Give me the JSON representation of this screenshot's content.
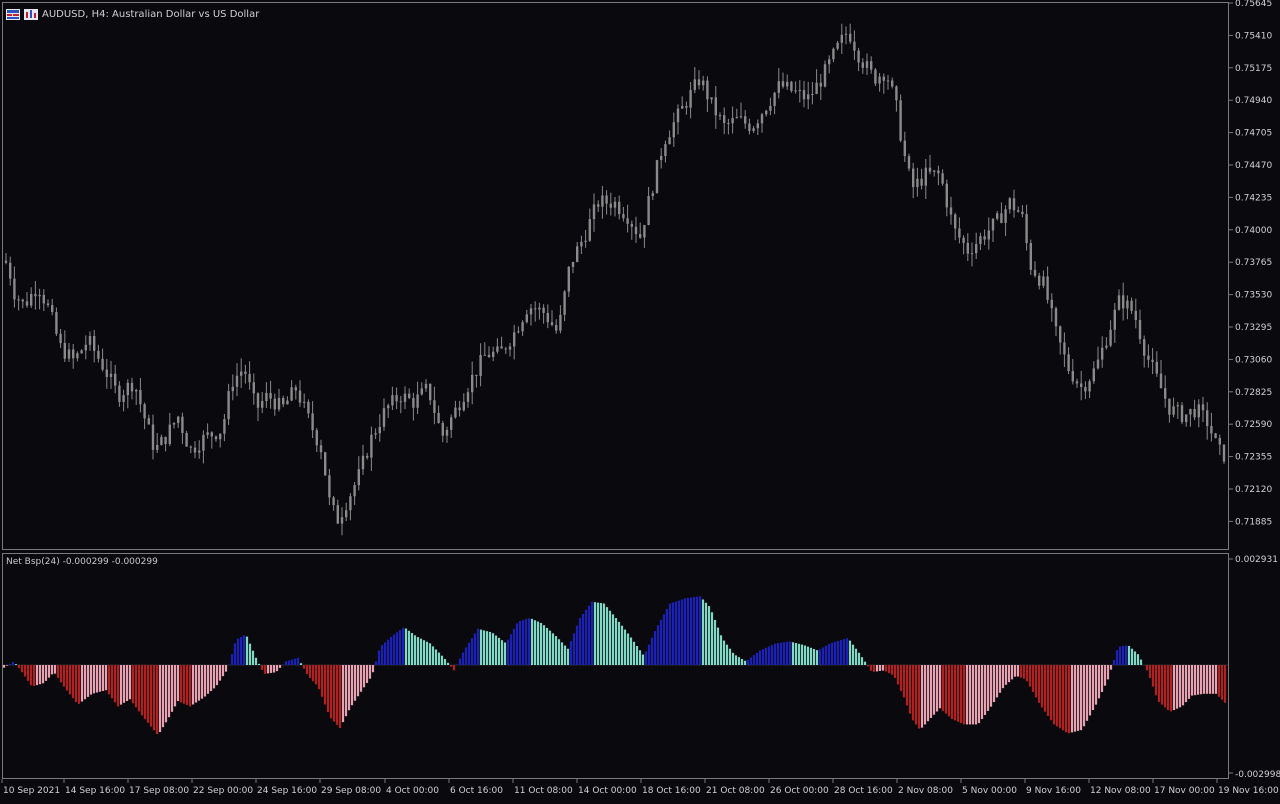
{
  "window": {
    "symbol_line": "AUDUSD, H4:  Australian Dollar vs US Dollar"
  },
  "colors": {
    "background": "#0a0a0e",
    "grid_text": "#d0d0d0",
    "axis_line": "#7a7a7a",
    "candle": "#8a8a8a",
    "hist_pos_strong": "#1b20b8",
    "hist_pos_weak": "#7fd9c5",
    "hist_neg_strong": "#b32020",
    "hist_neg_weak": "#e8a2b2",
    "hist_outline_pos": "#3a40e0",
    "hist_outline_neg": "#c03040"
  },
  "icons": [
    "window-list-icon",
    "chart-properties-icon"
  ],
  "price_axis": {
    "labels": [
      "0.75645",
      "0.75410",
      "0.75175",
      "0.74940",
      "0.74705",
      "0.74470",
      "0.74235",
      "0.74000",
      "0.73765",
      "0.73530",
      "0.73295",
      "0.73060",
      "0.72825",
      "0.72590",
      "0.72355",
      "0.72120",
      "0.71885"
    ]
  },
  "indicator": {
    "label": "Net Bsp(24) -0.000299 -0.000299",
    "max_label": "0.002931",
    "min_label": "-0.002998",
    "max": 0.002931,
    "min": -0.002998
  },
  "time_axis": {
    "labels": [
      "10 Sep 2021",
      "14 Sep 16:00",
      "17 Sep 08:00",
      "22 Sep 00:00",
      "24 Sep 16:00",
      "29 Sep 08:00",
      "4 Oct 00:00",
      "6 Oct 16:00",
      "11 Oct 08:00",
      "14 Oct 00:00",
      "18 Oct 16:00",
      "21 Oct 08:00",
      "26 Oct 00:00",
      "28 Oct 16:00",
      "2 Nov 08:00",
      "5 Nov 00:00",
      "9 Nov 16:00",
      "12 Nov 08:00",
      "17 Nov 00:00",
      "19 Nov 16:00"
    ]
  },
  "chart_data": [
    {
      "type": "candlestick",
      "title": "AUDUSD, H4:  Australian Dollar vs US Dollar",
      "ylim": [
        0.7176,
        0.7566
      ],
      "x_labels": [
        "10 Sep 2021",
        "14 Sep 16:00",
        "17 Sep 08:00",
        "22 Sep 00:00",
        "24 Sep 16:00",
        "29 Sep 08:00",
        "4 Oct 00:00",
        "6 Oct 16:00",
        "11 Oct 08:00",
        "14 Oct 00:00",
        "18 Oct 16:00",
        "21 Oct 08:00",
        "26 Oct 00:00",
        "28 Oct 16:00",
        "2 Nov 08:00",
        "5 Nov 00:00",
        "9 Nov 16:00",
        "12 Nov 08:00",
        "17 Nov 00:00",
        "19 Nov 16:00"
      ],
      "close_path": [
        [
          0,
          0.738
        ],
        [
          8,
          0.7375
        ],
        [
          14,
          0.7355
        ],
        [
          24,
          0.7345
        ],
        [
          38,
          0.736
        ],
        [
          50,
          0.734
        ],
        [
          60,
          0.7315
        ],
        [
          74,
          0.7305
        ],
        [
          88,
          0.732
        ],
        [
          104,
          0.73
        ],
        [
          118,
          0.728
        ],
        [
          134,
          0.729
        ],
        [
          144,
          0.7265
        ],
        [
          155,
          0.724
        ],
        [
          166,
          0.725
        ],
        [
          178,
          0.7265
        ],
        [
          190,
          0.724
        ],
        [
          206,
          0.725
        ],
        [
          222,
          0.7255
        ],
        [
          232,
          0.729
        ],
        [
          244,
          0.73
        ],
        [
          256,
          0.727
        ],
        [
          268,
          0.728
        ],
        [
          282,
          0.727
        ],
        [
          296,
          0.7285
        ],
        [
          310,
          0.726
        ],
        [
          322,
          0.724
        ],
        [
          330,
          0.72
        ],
        [
          338,
          0.719
        ],
        [
          348,
          0.7205
        ],
        [
          358,
          0.722
        ],
        [
          372,
          0.725
        ],
        [
          386,
          0.727
        ],
        [
          400,
          0.728
        ],
        [
          414,
          0.7275
        ],
        [
          428,
          0.7285
        ],
        [
          442,
          0.725
        ],
        [
          456,
          0.727
        ],
        [
          470,
          0.729
        ],
        [
          486,
          0.731
        ],
        [
          500,
          0.731
        ],
        [
          514,
          0.7325
        ],
        [
          528,
          0.7345
        ],
        [
          544,
          0.734
        ],
        [
          558,
          0.7325
        ],
        [
          570,
          0.7375
        ],
        [
          584,
          0.7395
        ],
        [
          598,
          0.742
        ],
        [
          614,
          0.742
        ],
        [
          628,
          0.741
        ],
        [
          640,
          0.7395
        ],
        [
          652,
          0.743
        ],
        [
          664,
          0.7465
        ],
        [
          676,
          0.748
        ],
        [
          688,
          0.7495
        ],
        [
          700,
          0.751
        ],
        [
          712,
          0.749
        ],
        [
          724,
          0.7475
        ],
        [
          738,
          0.748
        ],
        [
          752,
          0.7475
        ],
        [
          766,
          0.749
        ],
        [
          780,
          0.7505
        ],
        [
          794,
          0.75
        ],
        [
          808,
          0.7495
        ],
        [
          822,
          0.751
        ],
        [
          836,
          0.753
        ],
        [
          848,
          0.7545
        ],
        [
          860,
          0.7525
        ],
        [
          874,
          0.751
        ],
        [
          886,
          0.7515
        ],
        [
          896,
          0.749
        ],
        [
          904,
          0.7455
        ],
        [
          912,
          0.743
        ],
        [
          926,
          0.744
        ],
        [
          940,
          0.744
        ],
        [
          954,
          0.74
        ],
        [
          968,
          0.7385
        ],
        [
          982,
          0.7395
        ],
        [
          996,
          0.7405
        ],
        [
          1010,
          0.742
        ],
        [
          1022,
          0.741
        ],
        [
          1030,
          0.7375
        ],
        [
          1044,
          0.736
        ],
        [
          1056,
          0.7325
        ],
        [
          1068,
          0.73
        ],
        [
          1082,
          0.7285
        ],
        [
          1096,
          0.73
        ],
        [
          1108,
          0.7325
        ],
        [
          1120,
          0.735
        ],
        [
          1134,
          0.734
        ],
        [
          1146,
          0.731
        ],
        [
          1158,
          0.729
        ],
        [
          1170,
          0.727
        ],
        [
          1184,
          0.7265
        ],
        [
          1196,
          0.727
        ],
        [
          1208,
          0.726
        ],
        [
          1218,
          0.724
        ],
        [
          1227,
          0.7235
        ]
      ]
    },
    {
      "type": "bar",
      "title": "Net Bsp(24) -0.000299 -0.000299",
      "ylim": [
        -0.002998,
        0.002931
      ],
      "value_path": [
        [
          0,
          -0.00015
        ],
        [
          8,
          0.0
        ],
        [
          14,
          0.0001
        ],
        [
          22,
          -0.0002
        ],
        [
          32,
          -0.0006
        ],
        [
          44,
          -0.0005
        ],
        [
          54,
          -0.0002
        ],
        [
          64,
          -0.0006
        ],
        [
          78,
          -0.0011
        ],
        [
          92,
          -0.0008
        ],
        [
          106,
          -0.0007
        ],
        [
          118,
          -0.00115
        ],
        [
          130,
          -0.00095
        ],
        [
          142,
          -0.0014
        ],
        [
          158,
          -0.00195
        ],
        [
          168,
          -0.0015
        ],
        [
          178,
          -0.001
        ],
        [
          190,
          -0.00115
        ],
        [
          204,
          -0.0009
        ],
        [
          216,
          -0.0006
        ],
        [
          228,
          -0.0001
        ],
        [
          236,
          0.0007
        ],
        [
          246,
          0.00085
        ],
        [
          256,
          0.0002
        ],
        [
          264,
          -0.00025
        ],
        [
          276,
          -0.0002
        ],
        [
          286,
          0.0001
        ],
        [
          298,
          0.0002
        ],
        [
          308,
          -0.0003
        ],
        [
          318,
          -0.0006
        ],
        [
          330,
          -0.00145
        ],
        [
          340,
          -0.00175
        ],
        [
          350,
          -0.0012
        ],
        [
          362,
          -0.0007
        ],
        [
          372,
          -0.0003
        ],
        [
          380,
          0.0005
        ],
        [
          392,
          0.0008
        ],
        [
          404,
          0.00105
        ],
        [
          416,
          0.0008
        ],
        [
          430,
          0.0006
        ],
        [
          444,
          0.0002
        ],
        [
          454,
          -0.00015
        ],
        [
          464,
          0.0004
        ],
        [
          478,
          0.001
        ],
        [
          492,
          0.0009
        ],
        [
          506,
          0.0006
        ],
        [
          518,
          0.0012
        ],
        [
          530,
          0.0013
        ],
        [
          542,
          0.00115
        ],
        [
          556,
          0.0008
        ],
        [
          568,
          0.00045
        ],
        [
          580,
          0.0013
        ],
        [
          592,
          0.00175
        ],
        [
          604,
          0.0017
        ],
        [
          616,
          0.0013
        ],
        [
          630,
          0.0008
        ],
        [
          644,
          0.00025
        ],
        [
          656,
          0.001
        ],
        [
          670,
          0.0017
        ],
        [
          686,
          0.00185
        ],
        [
          700,
          0.0019
        ],
        [
          710,
          0.0016
        ],
        [
          722,
          0.00075
        ],
        [
          734,
          0.0003
        ],
        [
          746,
          0.0001
        ],
        [
          760,
          0.0004
        ],
        [
          776,
          0.0006
        ],
        [
          790,
          0.00065
        ],
        [
          804,
          0.00055
        ],
        [
          818,
          0.0004
        ],
        [
          830,
          0.0006
        ],
        [
          848,
          0.00075
        ],
        [
          860,
          0.0003
        ],
        [
          872,
          -0.0002
        ],
        [
          884,
          -0.00015
        ],
        [
          894,
          -0.0003
        ],
        [
          904,
          -0.0009
        ],
        [
          912,
          -0.0015
        ],
        [
          920,
          -0.0018
        ],
        [
          930,
          -0.0015
        ],
        [
          940,
          -0.0012
        ],
        [
          952,
          -0.0015
        ],
        [
          964,
          -0.00165
        ],
        [
          978,
          -0.00165
        ],
        [
          990,
          -0.0012
        ],
        [
          1004,
          -0.0006
        ],
        [
          1016,
          -0.0003
        ],
        [
          1026,
          -0.0004
        ],
        [
          1040,
          -0.0011
        ],
        [
          1054,
          -0.00165
        ],
        [
          1068,
          -0.0019
        ],
        [
          1082,
          -0.0018
        ],
        [
          1096,
          -0.0011
        ],
        [
          1108,
          -0.0004
        ],
        [
          1118,
          0.0005
        ],
        [
          1128,
          0.00055
        ],
        [
          1138,
          0.0003
        ],
        [
          1148,
          -0.0002
        ],
        [
          1158,
          -0.001
        ],
        [
          1170,
          -0.0013
        ],
        [
          1182,
          -0.00115
        ],
        [
          1192,
          -0.00085
        ],
        [
          1204,
          -0.0008
        ],
        [
          1216,
          -0.0008
        ],
        [
          1227,
          -0.0011
        ]
      ]
    }
  ]
}
